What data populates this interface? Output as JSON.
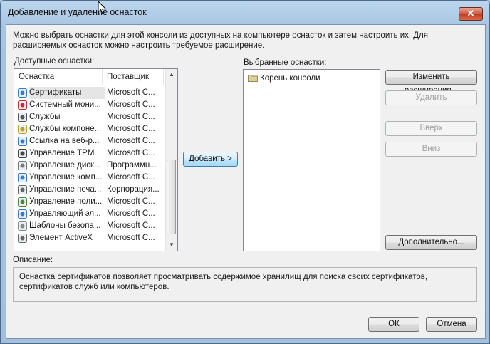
{
  "window": {
    "title": "Добавление и удаление оснасток",
    "close_glyph": "✕"
  },
  "intro": "Можно выбрать оснастки для этой консоли из доступных на компьютере оснасток и затем настроить их. Для расширяемых оснасток можно настроить требуемое расширение.",
  "available": {
    "label": "Доступные оснастки:",
    "columns": [
      "Оснастка",
      "Поставщик"
    ],
    "items": [
      {
        "name": "Сертификаты",
        "vendor": "Microsoft C...",
        "icon": "certificates-icon",
        "selected": true
      },
      {
        "name": "Системный мони...",
        "vendor": "Microsoft C...",
        "icon": "system-monitor-icon"
      },
      {
        "name": "Службы",
        "vendor": "Microsoft C...",
        "icon": "services-gear-icon"
      },
      {
        "name": "Службы компоне...",
        "vendor": "Microsoft C...",
        "icon": "component-services-icon"
      },
      {
        "name": "Ссылка на веб-р...",
        "vendor": "Microsoft C...",
        "icon": "web-link-icon"
      },
      {
        "name": "Управление TPM",
        "vendor": "Microsoft C...",
        "icon": "tpm-icon"
      },
      {
        "name": "Управление диск...",
        "vendor": "Программн...",
        "icon": "disk-management-icon"
      },
      {
        "name": "Управление комп...",
        "vendor": "Microsoft C...",
        "icon": "computer-management-icon"
      },
      {
        "name": "Управление печа...",
        "vendor": "Корпорация...",
        "icon": "print-management-icon"
      },
      {
        "name": "Управление поли...",
        "vendor": "Microsoft C...",
        "icon": "policy-management-icon"
      },
      {
        "name": "Управляющий эл...",
        "vendor": "Microsoft C...",
        "icon": "control-element-icon"
      },
      {
        "name": "Шаблоны безопа...",
        "vendor": "Microsoft C...",
        "icon": "security-templates-icon"
      },
      {
        "name": "Элемент ActiveX",
        "vendor": "Microsoft C...",
        "icon": "activex-icon"
      }
    ]
  },
  "add_button": "Добавить >",
  "selected": {
    "label": "Выбранные оснастки:",
    "items": [
      {
        "name": "Корень консоли",
        "icon": "folder-icon"
      }
    ]
  },
  "buttons": {
    "edit_extensions": "Изменить расширения...",
    "remove": "Удалить",
    "up": "Вверх",
    "down": "Вниз",
    "advanced": "Дополнительно..."
  },
  "description": {
    "label": "Описание:",
    "text": "Оснастка сертификатов позволяет просматривать содержимое хранилищ для поиска своих сертификатов, сертификатов служб или компьютеров."
  },
  "footer": {
    "ok": "ОК",
    "cancel": "Отмена"
  }
}
